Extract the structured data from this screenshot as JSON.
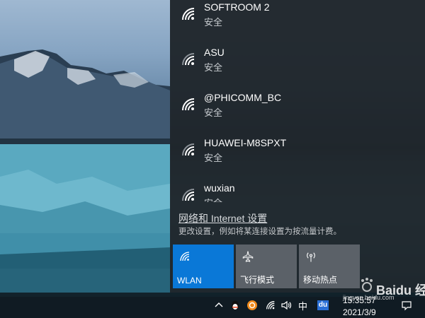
{
  "networks": [
    {
      "name": "SOFTROOM 2",
      "status": "安全"
    },
    {
      "name": "ASU",
      "status": "安全"
    },
    {
      "name": "@PHICOMM_BC",
      "status": "安全"
    },
    {
      "name": "HUAWEI-M8SPXT",
      "status": "安全"
    },
    {
      "name": "wuxian",
      "status": "安全"
    }
  ],
  "settings": {
    "link": "网络和 Internet 设置",
    "description": "更改设置，例如将某连接设置为按流量计费。"
  },
  "tiles": {
    "wlan": "WLAN",
    "airplane": "飞行模式",
    "hotspot": "移动热点"
  },
  "taskbar": {
    "ime": "中",
    "du": "du",
    "time": "15:35:57",
    "date": "2021/3/9"
  },
  "watermark": {
    "text": "Baidu 经验",
    "url": "jingyan.baidu.com"
  },
  "colors": {
    "accent": "#0a78d7",
    "flyout_bg": "#1f252b",
    "tile_inactive": "#5b6168"
  }
}
